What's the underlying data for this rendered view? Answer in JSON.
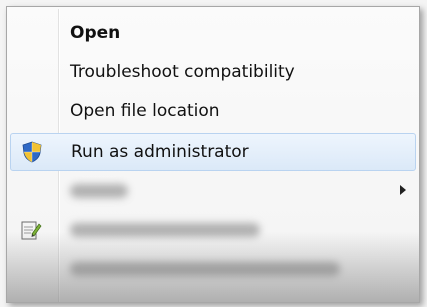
{
  "context_menu": {
    "items": [
      {
        "label": "Open"
      },
      {
        "label": "Troubleshoot compatibility"
      },
      {
        "label": "Open file location"
      },
      {
        "label": "Run as administrator",
        "icon": "uac-shield-icon"
      }
    ],
    "obscured_items": [
      {
        "has_submenu": true
      },
      {
        "icon": "notepad-edit-icon"
      },
      {}
    ]
  },
  "colors": {
    "highlight_border": "#b9d3f0",
    "highlight_fill": "#dbe9f8",
    "shield_blue": "#2f69c6",
    "shield_yellow": "#f2c233"
  }
}
